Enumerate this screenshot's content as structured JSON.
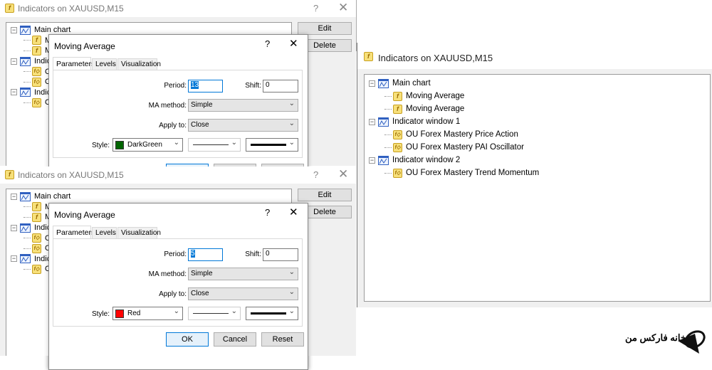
{
  "window_title": "Indicators on XAUUSD,M15",
  "help_glyph": "?",
  "close_glyph": "✕",
  "tree": [
    {
      "label": "Main chart",
      "children": [
        "Moving Average",
        "Moving Average"
      ]
    },
    {
      "label": "Indicator window 1",
      "children": [
        "OU Forex Mastery Price Action",
        "OU Forex Mastery PAI Oscillator"
      ]
    },
    {
      "label": "Indicator window 2",
      "children": [
        "OU Forex Mastery Trend Momentum"
      ]
    }
  ],
  "side_buttons": {
    "edit": "Edit",
    "delete": "Delete"
  },
  "dialogs": [
    {
      "title": "Moving Average",
      "tabs": [
        "Parameters",
        "Levels",
        "Visualization"
      ],
      "active_tab": "Parameters",
      "period_label": "Period:",
      "period": "13",
      "shift_label": "Shift:",
      "shift": "0",
      "ma_method_label": "MA method:",
      "ma_method": "Simple",
      "apply_label": "Apply to:",
      "apply": "Close",
      "style_label": "Style:",
      "color_name": "DarkGreen",
      "color": "#006400",
      "buttons": {
        "ok": "OK",
        "cancel": "Cancel",
        "reset": "Reset"
      }
    },
    {
      "title": "Moving Average",
      "tabs": [
        "Parameters",
        "Levels",
        "Visualization"
      ],
      "active_tab": "Parameters",
      "period_label": "Period:",
      "period": "5",
      "shift_label": "Shift:",
      "shift": "0",
      "ma_method_label": "MA method:",
      "ma_method": "Simple",
      "apply_label": "Apply to:",
      "apply": "Close",
      "style_label": "Style:",
      "color_name": "Red",
      "color": "#ff0000",
      "buttons": {
        "ok": "OK",
        "cancel": "Cancel",
        "reset": "Reset"
      }
    }
  ],
  "logo_text": "خانه فارکس من"
}
